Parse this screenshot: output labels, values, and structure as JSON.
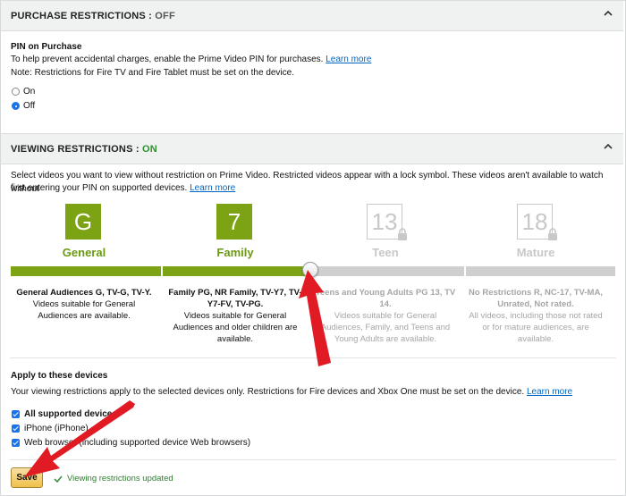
{
  "purchase": {
    "header_label": "PURCHASE RESTRICTIONS : ",
    "header_state": "OFF",
    "pin_title": "PIN on Purchase",
    "pin_desc": "To help prevent accidental charges, enable the Prime Video PIN for purchases.",
    "learn_more": "Learn more",
    "note": "Note: Restrictions for Fire TV and Fire Tablet must be set on the device.",
    "options": [
      {
        "label": "On",
        "selected": false
      },
      {
        "label": "Off",
        "selected": true
      }
    ]
  },
  "viewing": {
    "header_label": "VIEWING RESTRICTIONS : ",
    "header_state": "ON",
    "desc_line1": "Select videos you want to view without restriction on Prime Video. Restricted videos appear with a lock symbol. These videos aren't available to watch without",
    "desc_line2": "first entering your PIN on supported devices.",
    "learn_more": "Learn more",
    "tiers": [
      {
        "symbol": "G",
        "name": "General",
        "locked": false,
        "desc_head": "General Audiences G, TV-G, TV-Y.",
        "desc_body": "Videos suitable for General Audiences are available."
      },
      {
        "symbol": "7",
        "name": "Family",
        "locked": false,
        "desc_head": "Family PG, NR Family, TV-Y7, TV-Y7-FV, TV-PG.",
        "desc_body": "Videos suitable for General Audiences and older children are available."
      },
      {
        "symbol": "13",
        "name": "Teen",
        "locked": true,
        "desc_head": "Teens and Young Adults PG 13, TV 14.",
        "desc_body": "Videos suitable for General Audiences, Family, and Teens and Young Adults are available."
      },
      {
        "symbol": "18",
        "name": "Mature",
        "locked": true,
        "desc_head": "No Restrictions R, NC-17, TV-MA, Unrated, Not rated.",
        "desc_body": "All videos, including those not rated or for mature audiences, are available."
      }
    ],
    "slider_selected": "Family"
  },
  "devices": {
    "title": "Apply to these devices",
    "desc": "Your viewing restrictions apply to the selected devices only. Restrictions for Fire devices and Xbox One must be set on the device.",
    "learn_more": "Learn more",
    "items": [
      {
        "label": "All supported devices",
        "checked": true
      },
      {
        "label": "iPhone (iPhone)",
        "checked": true
      },
      {
        "label": "Web browser (including supported device Web browsers)",
        "checked": true
      }
    ]
  },
  "footer": {
    "save_label": "Save",
    "status": "Viewing restrictions updated"
  },
  "colors": {
    "accent_green": "#7ca313",
    "link_blue": "#0066c0",
    "checkbox_blue": "#1a73e8",
    "save_yellow": "#f0c14b",
    "annotation_red": "#e01b24"
  },
  "icons": {
    "chevron": "chevron-up-icon",
    "lock": "lock-icon",
    "check": "check-icon"
  }
}
